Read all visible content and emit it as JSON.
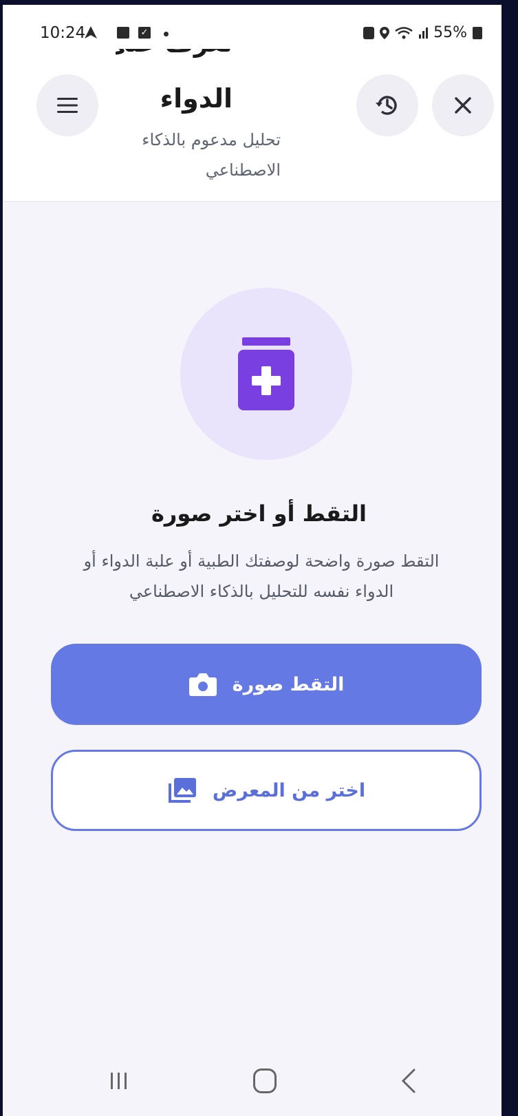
{
  "status_bar": {
    "time": "10:24",
    "battery": "55%"
  },
  "header": {
    "title_partial": "تعرف على",
    "title": "الدواء",
    "subtitle": "تحليل مدعوم بالذكاء الاصطناعي",
    "menu_icon": "menu-icon",
    "history_icon": "history-icon",
    "close_icon": "close-icon"
  },
  "hero": {
    "icon": "medicine-bottle-icon",
    "heading": "التقط أو اختر صورة",
    "description": "التقط صورة واضحة لوصفتك الطبية أو علبة الدواء أو الدواء نفسه للتحليل بالذكاء الاصطناعي"
  },
  "actions": {
    "camera_label": "التقط صورة",
    "camera_icon": "camera-icon",
    "gallery_label": "اختر من المعرض",
    "gallery_icon": "gallery-icon"
  },
  "colors": {
    "accent": "#6479e4",
    "hero_bg": "#e9e3fb",
    "icon_purple": "#7a3fe0"
  }
}
